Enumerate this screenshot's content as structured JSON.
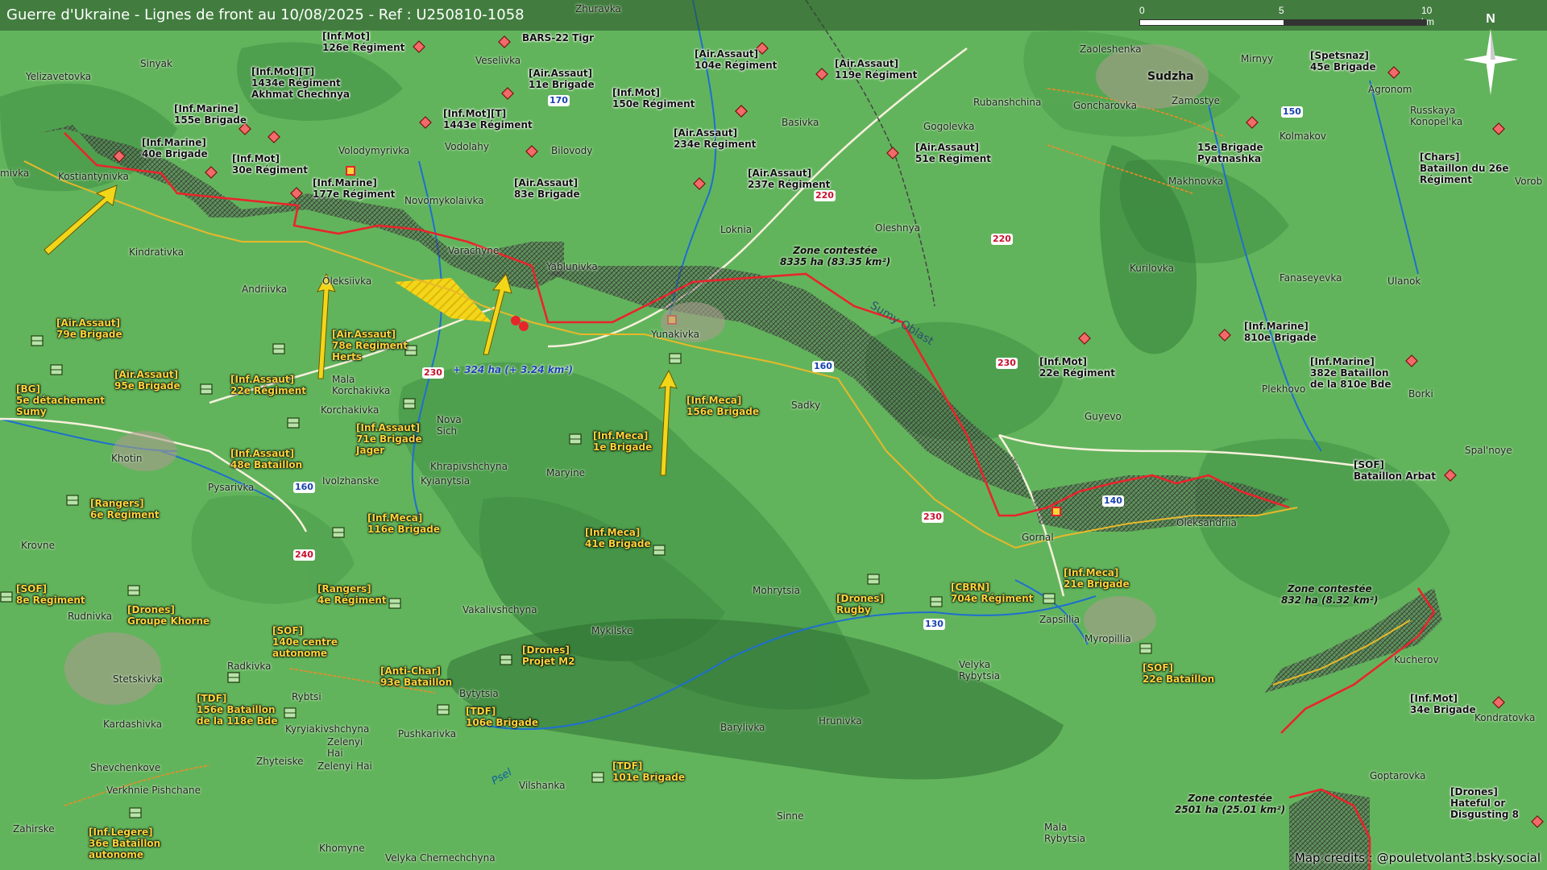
{
  "title": "Guerre d'Ukraine - Lignes de front au 10/08/2025 - Ref : U250810-1058",
  "scale": {
    "t0": "0",
    "t5": "5",
    "t10": "10 km"
  },
  "north_label": "N",
  "credits": "Map credits : @pouletvolant3.bsky.social",
  "zones": {
    "z1": {
      "line1": "Zone contestée",
      "line2": "8335 ha (83.35 km²)"
    },
    "z2": {
      "line1": "Zone contestée",
      "line2": "832 ha (8.32 km²)"
    },
    "z3": {
      "line1": "Zone contestée",
      "line2": "2501 ha (25.01 km²)"
    },
    "gain": "+ 324 ha (+ 3.24 km²)"
  },
  "oblast": "Sumy Oblast",
  "river": "Psel",
  "colors": {
    "russian_front": "#e8252b",
    "ukrainian_front": "#e8b82a",
    "contested_hatch": "#2e2e2e",
    "advance": "#f2d61a",
    "terrain": "#5fb05a"
  },
  "towns": {
    "zhuravka": "Zhuravka",
    "sinyak": "Sinyak",
    "yelizavetovka": "Yelizavetovka",
    "veselivka": "Veselivka",
    "vodolahy": "Vodolahy",
    "bilovody": "Bilovody",
    "basivka": "Basivka",
    "gogolevka": "Gogolevka",
    "zaoleshenka": "Zaoleshenka",
    "sudzha": "Sudzha",
    "mirnyy": "Mirnyy",
    "zamostye": "Zamostye",
    "goncharovka": "Goncharovka",
    "rubanshchina": "Rubanshchina",
    "agronom": "Agronom",
    "kolmakov": "Kolmakov",
    "russkaya": "Russkaya\nKonopel'ka",
    "makhnovka": "Makhnovka",
    "vorob": "Vorob",
    "kostiantynivka": "Kostiantynivka",
    "mivka": "mivka",
    "volodymyrivka": "Volodymyrivka",
    "novomykolaivka": "Novomykolaivka",
    "kindrativka": "Kindrativka",
    "varachyne": "Varachyne",
    "yablunivka": "Yablunivka",
    "loknia": "Loknia",
    "oleshnya": "Oleshnya",
    "andriivka": "Andriivka",
    "oleksiivka": "Oleksiivka",
    "yunakivka": "Yunakivka",
    "sadky": "Sadky",
    "kurilovka": "Kurilovka",
    "fanaseyevka": "Fanaseyevka",
    "ulanok": "Ulanok",
    "mala_korchakivka": "Mala\nKorchakivka",
    "korchakivka": "Korchakivka",
    "nova_sich": "Nova\nSich",
    "khrapivshchyna": "Khrapivshchyna",
    "kyianytsia": "Kyianytsia",
    "ivolzhanske": "Ivolzhanske",
    "maryine": "Maryine",
    "khotin": "Khotin",
    "pysarivka": "Pysarivka",
    "guyevo": "Guyevo",
    "plekhovo": "Plekhovo",
    "borki": "Borki",
    "spalnoye": "Spal'noye",
    "gornal": "Gornal",
    "oleksandriia": "Oleksandriia",
    "krovne": "Krovne",
    "mohrytsia": "Mohrytsia",
    "rudnivka": "Rudnivka",
    "vakalivshchyna": "Vakalivshchyna",
    "mykilske": "Mykilske",
    "zapsillia": "Zapsillia",
    "myropillia": "Myropillia",
    "kucherov": "Kucherov",
    "kondratovka": "Kondratovka",
    "stetskivka": "Stetskivka",
    "radkivka": "Radkivka",
    "rybtsi": "Rybtsi",
    "kardashivka": "Kardashivka",
    "bytytsia": "Bytytsia",
    "pushkarivka": "Pushkarivka",
    "kyryiakivshchyna": "Kyryiakivshchyna",
    "zeleny": "Zelenyi\nHai",
    "zhytieske": "Zhyteiske",
    "zelenyi_hai": "Zelenyi Hai",
    "shevchenkove": "Shevchenkove",
    "verkhnie": "Verkhnie Pishchane",
    "zahirske": "Zahirske",
    "velyka_rybytsia": "Velyka\nRybytsia",
    "barylivka": "Barylivka",
    "hrunivka": "Hrunivka",
    "goptarovka": "Goptarovka",
    "vilshanka": "Vilshanka",
    "sinne": "Sinne",
    "mala_rybytsia": "Mala\nRybytsia",
    "khomyne": "Khomyne",
    "velyka_chernech": "Velyka Chernechchyna"
  },
  "roads": {
    "r170": "170",
    "r150": "150",
    "r220a": "220",
    "r220b": "220",
    "r230a": "230",
    "r230b": "230",
    "r230c": "230",
    "r160a": "160",
    "r160b": "160",
    "r140": "140",
    "r240": "240",
    "r130": "130"
  },
  "units_ru": [
    {
      "id": "u01",
      "text": "[Inf.Mot]\n126e Régiment"
    },
    {
      "id": "u02",
      "text": "BARS-22 Tigr"
    },
    {
      "id": "u03",
      "text": "[Air.Assaut]\n104e Régiment"
    },
    {
      "id": "u04",
      "text": "[Air.Assaut]\n119e Régiment"
    },
    {
      "id": "u05",
      "text": "[Inf.Mot][T]\n1434e Régiment\nAkhmat Chechnya"
    },
    {
      "id": "u06",
      "text": "[Air.Assaut]\n11e Brigade"
    },
    {
      "id": "u07",
      "text": "[Inf.Mot]\n150e Régiment"
    },
    {
      "id": "u08",
      "text": "[Inf.Marine]\n155e Brigade"
    },
    {
      "id": "u09",
      "text": "[Inf.Mot][T]\n1443e Régiment"
    },
    {
      "id": "u10",
      "text": "[Air.Assaut]\n234e Régiment"
    },
    {
      "id": "u11",
      "text": "[Air.Assaut]\n51e Régiment"
    },
    {
      "id": "u12",
      "text": "[Inf.Marine]\n40e Brigade"
    },
    {
      "id": "u13",
      "text": "[Inf.Mot]\n30e Régiment"
    },
    {
      "id": "u14",
      "text": "[Air.Assaut]\n237e Régiment"
    },
    {
      "id": "u15",
      "text": "[Inf.Marine]\n177e Régiment"
    },
    {
      "id": "u16",
      "text": "[Air.Assaut]\n83e Brigade"
    },
    {
      "id": "u17",
      "text": "[Spetsnaz]\n45e Brigade"
    },
    {
      "id": "u18",
      "text": "15e Brigade\nPyatnashka"
    },
    {
      "id": "u19",
      "text": "[Chars]\nBataillon du 26e\nRégiment"
    },
    {
      "id": "u20",
      "text": "[Inf.Marine]\n810e Brigade"
    },
    {
      "id": "u21",
      "text": "[Inf.Mot]\n22e Régiment"
    },
    {
      "id": "u22",
      "text": "[Inf.Marine]\n382e Bataillon\nde la 810e Bde"
    },
    {
      "id": "u23",
      "text": "[SOF]\nBataillon Arbat"
    },
    {
      "id": "u24",
      "text": "[Inf.Mot]\n34e Brigade"
    },
    {
      "id": "u25",
      "text": "[Drones]\nHateful or\nDisgusting 8"
    }
  ],
  "units_ua": [
    {
      "id": "a01",
      "text": "[Air.Assaut]\n79e Brigade"
    },
    {
      "id": "a02",
      "text": "[Air.Assaut]\n78e Régiment\nHerts"
    },
    {
      "id": "a03",
      "text": "[BG]\n5e détachement\nSumy"
    },
    {
      "id": "a04",
      "text": "[Air.Assaut]\n95e Brigade"
    },
    {
      "id": "a05",
      "text": "[Inf.Assaut]\n22e Régiment"
    },
    {
      "id": "a06",
      "text": "[Inf.Assaut]\n71e Brigade\nJager"
    },
    {
      "id": "a07",
      "text": "[Inf.Meca]\n156e Brigade"
    },
    {
      "id": "a08",
      "text": "[Inf.Meca]\n1e Brigade"
    },
    {
      "id": "a09",
      "text": "[Inf.Assaut]\n48e Bataillon"
    },
    {
      "id": "a10",
      "text": "[Rangers]\n6e Régiment"
    },
    {
      "id": "a11",
      "text": "[Inf.Meca]\n116e Brigade"
    },
    {
      "id": "a12",
      "text": "[Inf.Meca]\n41e Brigade"
    },
    {
      "id": "a13",
      "text": "[SOF]\n8e Régiment"
    },
    {
      "id": "a14",
      "text": "[Drones]\nGroupe Khorne"
    },
    {
      "id": "a15",
      "text": "[Rangers]\n4e Régiment"
    },
    {
      "id": "a16",
      "text": "[Drones]\nRugby"
    },
    {
      "id": "a17",
      "text": "[CBRN]\n704e Régiment"
    },
    {
      "id": "a18",
      "text": "[Inf.Meca]\n21e Brigade"
    },
    {
      "id": "a19",
      "text": "[SOF]\n140e centre\nautonome"
    },
    {
      "id": "a20",
      "text": "[Drones]\nProjet M2"
    },
    {
      "id": "a21",
      "text": "[Anti-Char]\n93e Bataillon"
    },
    {
      "id": "a22",
      "text": "[TDF]\n156e Bataillon\nde la 118e Bde"
    },
    {
      "id": "a23",
      "text": "[TDF]\n106e Brigade"
    },
    {
      "id": "a24",
      "text": "[SOF]\n22e Bataillon"
    },
    {
      "id": "a25",
      "text": "[TDF]\n101e Brigade"
    },
    {
      "id": "a26",
      "text": "[Inf.Legere]\n36e Bataillon\nautonome"
    }
  ]
}
